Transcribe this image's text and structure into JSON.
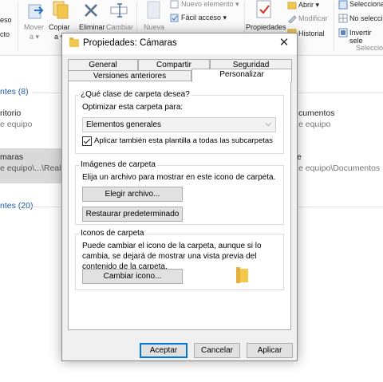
{
  "ribbon": {
    "left_partial": [
      "eso",
      "cto"
    ],
    "move_label": "Mover",
    "move_sub": "a ▾",
    "copy_label": "Copiar",
    "copy_sub": "a ▾",
    "delete_label": "Eliminar",
    "rename_label": "Cambiar",
    "new_label": "Nueva",
    "new_item_label": "Nuevo elemento ▾",
    "easy_access_label": "Fácil acceso ▾",
    "properties_label": "Propiedades",
    "open_label": "Abrir ▾",
    "modify_label": "Modificar",
    "history_label": "Historial",
    "select_all_label": "Selecciona",
    "select_none_label": "No selecci",
    "invert_label": "Invertir sele",
    "select_group_label": "Seleccio"
  },
  "explorer": {
    "group1_header": "ntes (8)",
    "group2_header": "ntes (20)",
    "item1_name": "ritorio",
    "item1_sub": "e equipo",
    "item2_name": "maras",
    "item2_sub": "e equipo\\...\\Realm",
    "item3_name": "cumentos",
    "item3_sub": "e equipo",
    "item4_name": "e",
    "item4_sub": "e equipo\\Documentos"
  },
  "dialog": {
    "title": "Propiedades: Cámaras",
    "close_glyph": "✕",
    "tabs": {
      "general": "General",
      "share": "Compartir",
      "security": "Seguridad",
      "previous": "Versiones anteriores",
      "customize": "Personalizar"
    },
    "folder_type": {
      "legend": "¿Qué clase de carpeta desea?",
      "optimize_label": "Optimizar esta carpeta para:",
      "selected_option": "Elementos generales",
      "apply_subfolders_label": "Aplicar también esta plantilla a todas las subcarpetas",
      "apply_subfolders_checked": true
    },
    "folder_images": {
      "legend": "Imágenes de carpeta",
      "description": "Elija un archivo para mostrar en este icono de carpeta.",
      "choose_file_button": "Elegir archivo...",
      "restore_default_button": "Restaurar predeterminado"
    },
    "folder_icons": {
      "legend": "Iconos de carpeta",
      "description": "Puede cambiar el icono de la carpeta, aunque si lo cambia, se dejará de mostrar una vista previa del contenido de la carpeta.",
      "change_icon_button": "Cambiar icono..."
    },
    "buttons": {
      "accept": "Aceptar",
      "cancel": "Cancelar",
      "apply": "Aplicar"
    }
  }
}
